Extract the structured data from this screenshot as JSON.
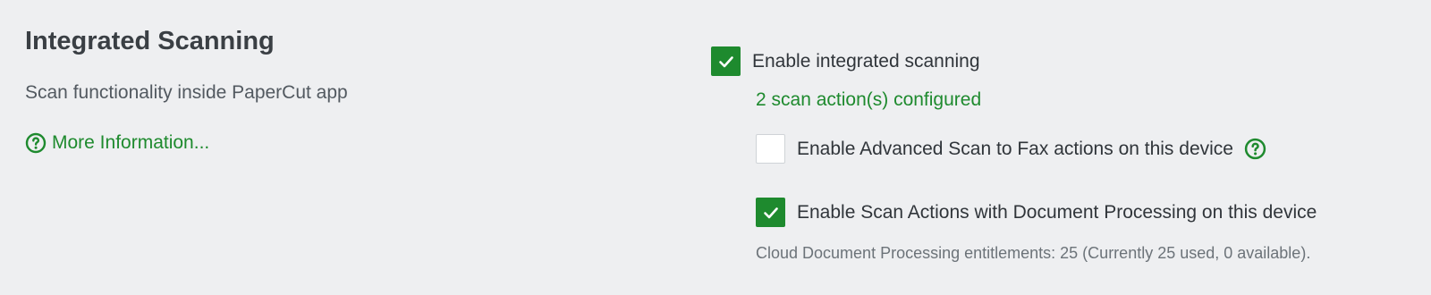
{
  "section": {
    "title": "Integrated Scanning",
    "description": "Scan functionality inside PaperCut app",
    "more_info_label": "More Information...",
    "help_icon": "question-circle-icon"
  },
  "settings": {
    "enable_scanning": {
      "label": "Enable integrated scanning",
      "checked": true
    },
    "status_text": "2 scan action(s) configured",
    "advanced_fax": {
      "label": "Enable Advanced Scan to Fax actions on this device",
      "checked": false
    },
    "document_processing": {
      "label": "Enable Scan Actions with Document Processing on this device",
      "checked": true
    },
    "entitlements_note": "Cloud Document Processing entitlements: 25 (Currently 25 used, 0 available)."
  },
  "colors": {
    "accent": "#1e8a2e",
    "background": "#eeeff1",
    "text": "#3a3f44",
    "muted": "#6c7379"
  }
}
